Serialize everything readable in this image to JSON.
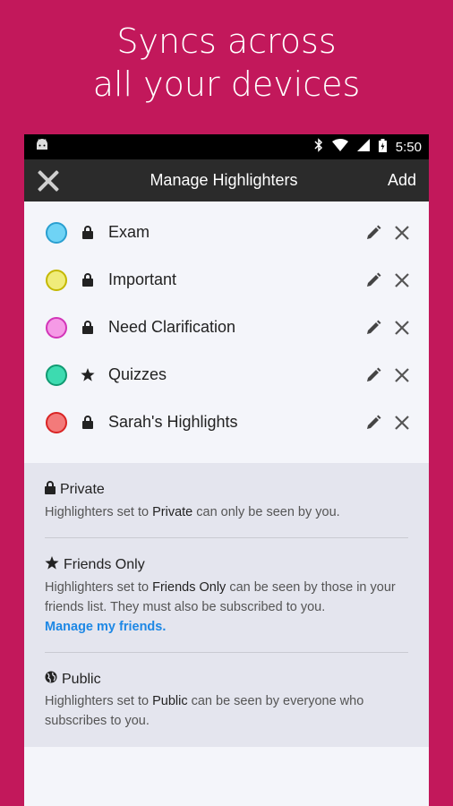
{
  "promo": {
    "line1": "Syncs across",
    "line2": "all your devices"
  },
  "status": {
    "time": "5:50"
  },
  "appbar": {
    "title": "Manage Highlighters",
    "add_label": "Add"
  },
  "highlighters": [
    {
      "label": "Exam",
      "fill": "#6fd3f5",
      "border": "#2a9fd0",
      "visibility": "private"
    },
    {
      "label": "Important",
      "fill": "#f0ec7a",
      "border": "#c4b800",
      "visibility": "private"
    },
    {
      "label": "Need Clarification",
      "fill": "#f59ae6",
      "border": "#d234b8",
      "visibility": "private"
    },
    {
      "label": "Quizzes",
      "fill": "#3ddbb0",
      "border": "#119a72",
      "visibility": "friends"
    },
    {
      "label": "Sarah's Highlights",
      "fill": "#f37a7a",
      "border": "#d92424",
      "visibility": "private"
    }
  ],
  "info": {
    "private": {
      "title": "Private",
      "pre": "Highlighters set to ",
      "em": "Private",
      "post": " can only be seen by you."
    },
    "friends": {
      "title": "Friends Only",
      "pre": "Highlighters set to ",
      "em": "Friends Only",
      "post": " can be seen by those in your friends list. They must also be subscribed to you.",
      "link": "Manage my friends."
    },
    "public": {
      "title": "Public",
      "pre": "Highlighters set to ",
      "em": "Public",
      "post": " can be seen by everyone who subscribes to you."
    }
  }
}
